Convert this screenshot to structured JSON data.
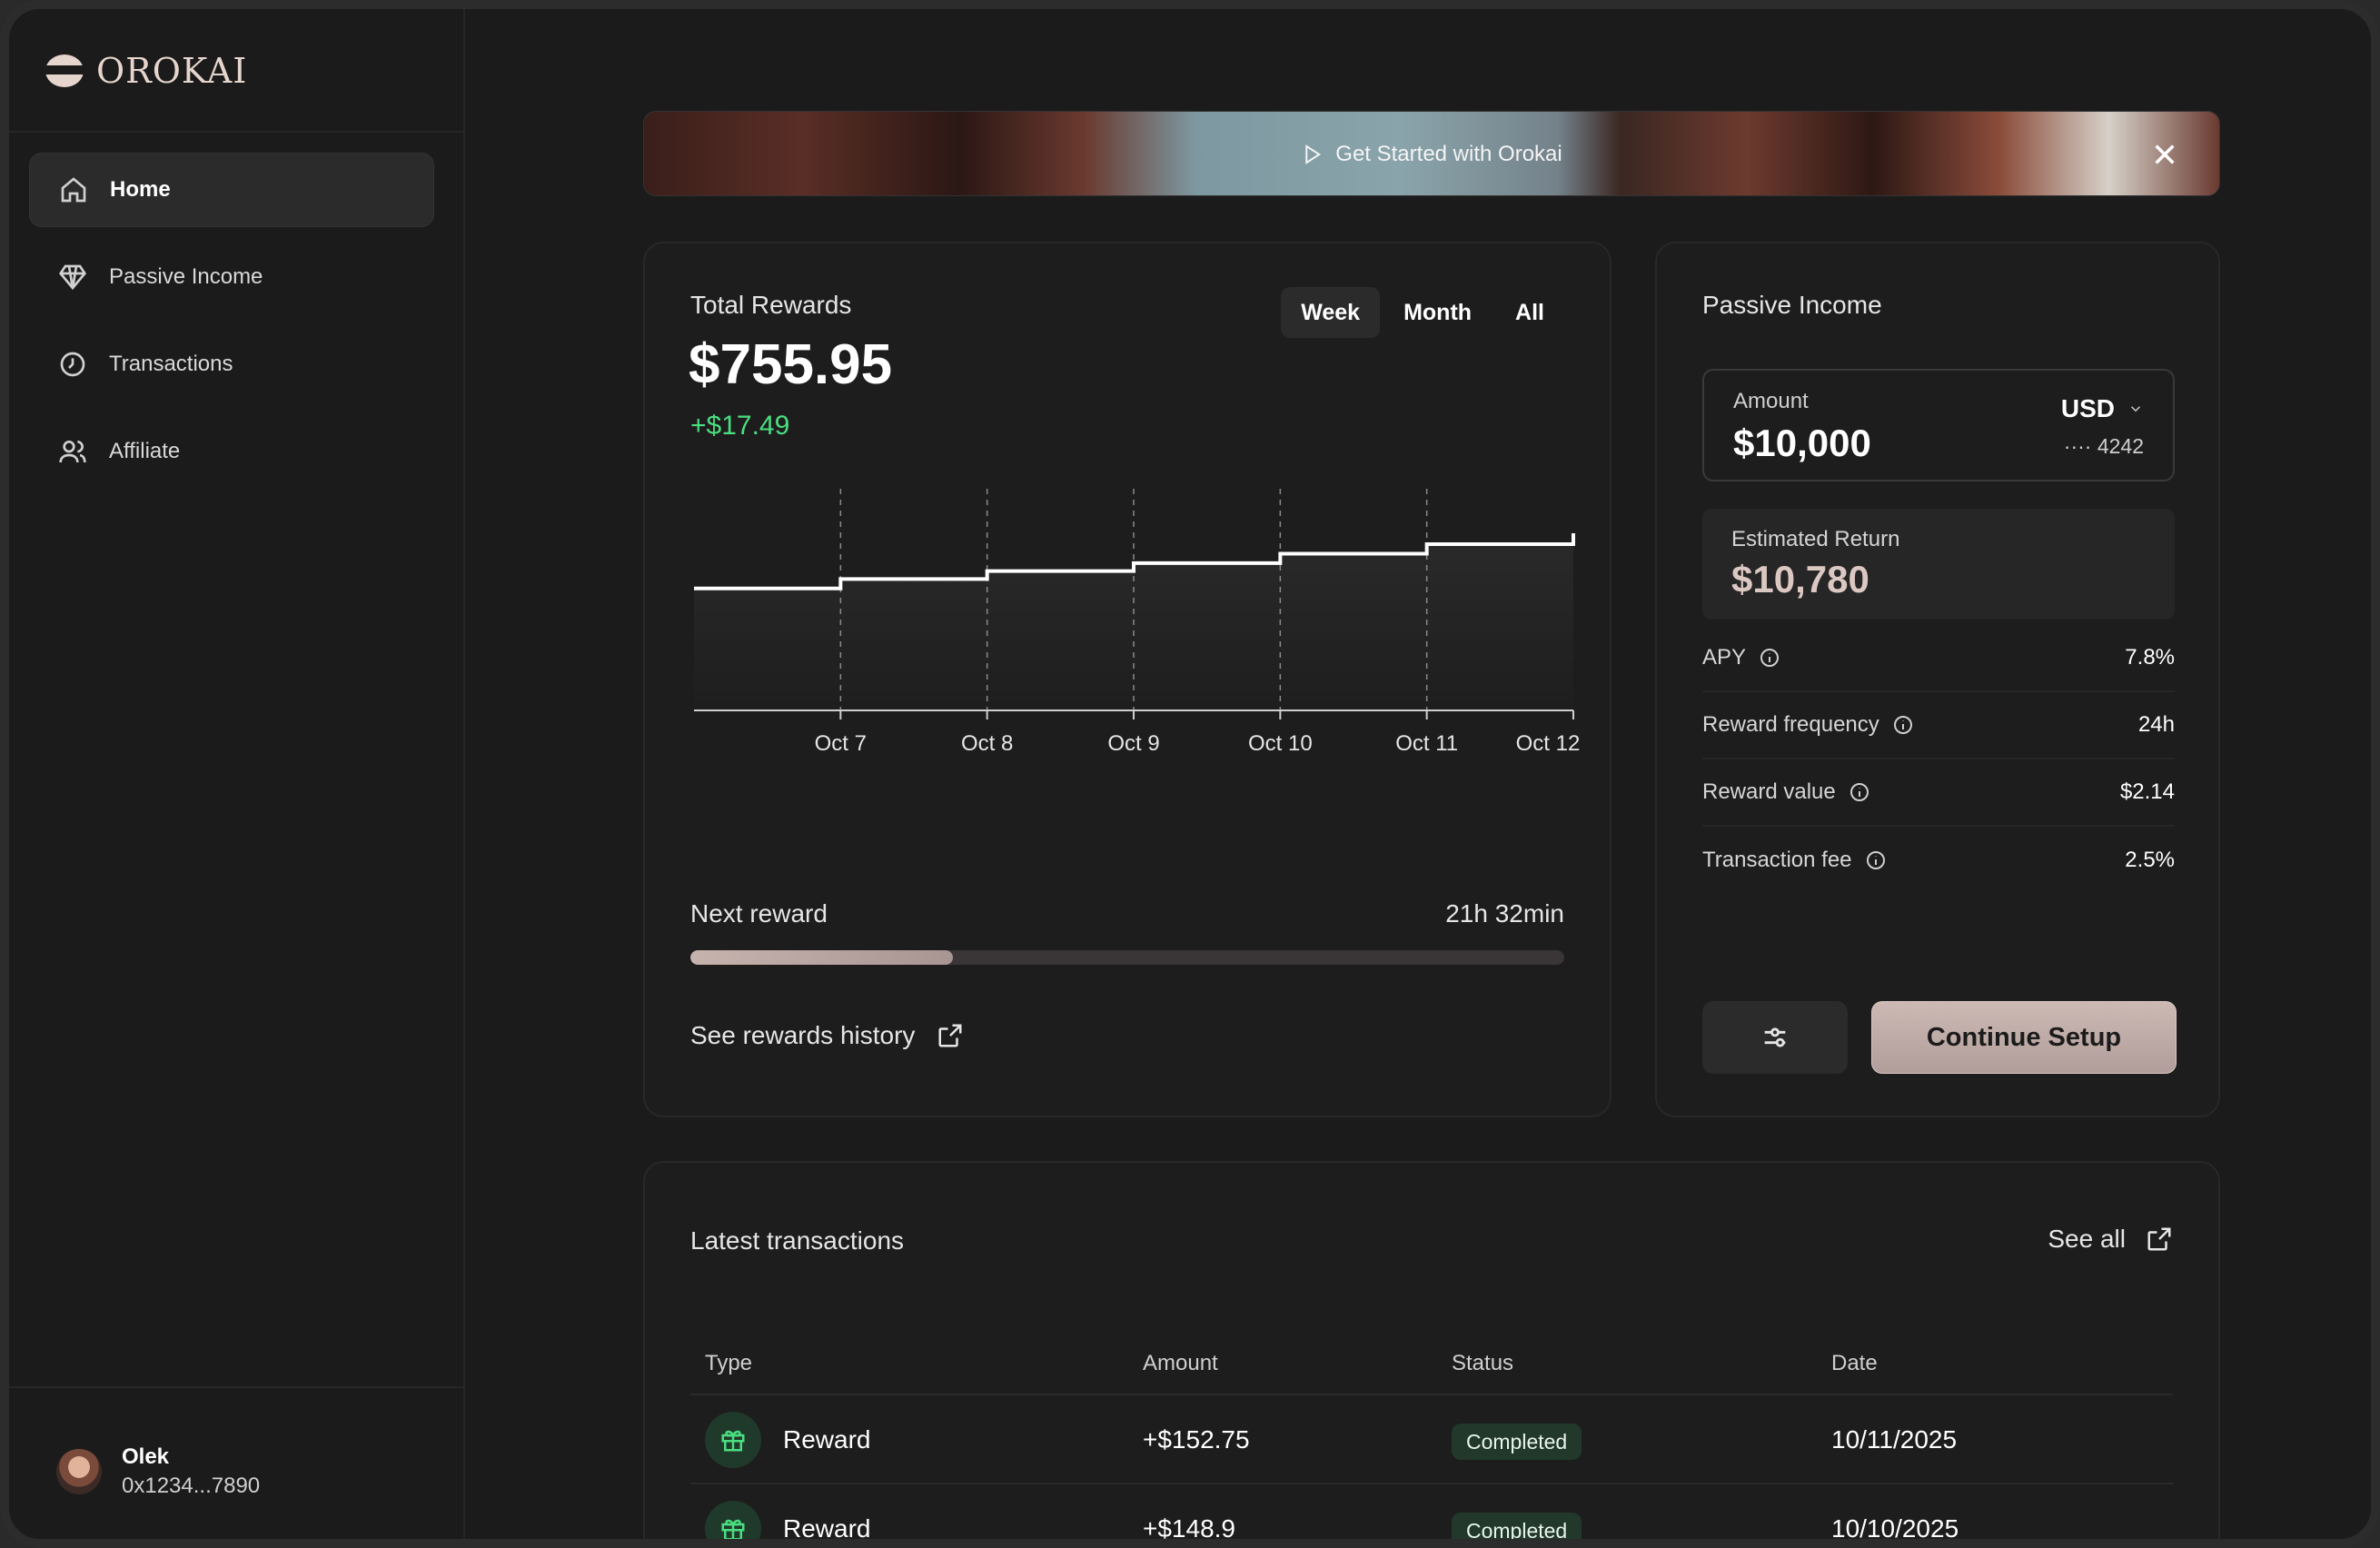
{
  "brand": {
    "name": "OROKAI"
  },
  "sidebar": {
    "items": [
      {
        "label": "Home",
        "icon": "home-icon",
        "active": true
      },
      {
        "label": "Passive Income",
        "icon": "diamond-icon",
        "active": false
      },
      {
        "label": "Transactions",
        "icon": "clock-icon",
        "active": false
      },
      {
        "label": "Affiliate",
        "icon": "users-icon",
        "active": false
      }
    ],
    "user": {
      "name": "Olek",
      "address": "0x1234...7890"
    }
  },
  "banner": {
    "cta": "Get Started with Orokai"
  },
  "rewards": {
    "label": "Total Rewards",
    "total": "$755.95",
    "delta": "+$17.49",
    "ranges": [
      "Week",
      "Month",
      "All"
    ],
    "active_range": "Week",
    "next_reward_label": "Next reward",
    "next_reward_time": "21h 32min",
    "progress": 0.3,
    "history_link": "See rewards history"
  },
  "chart_data": {
    "type": "area",
    "categories": [
      "",
      "Oct 7",
      "Oct 8",
      "Oct 9",
      "Oct 10",
      "Oct 11",
      "Oct 12"
    ],
    "tick_labels": [
      "Oct 7",
      "Oct 8",
      "Oct 9",
      "Oct 10",
      "Oct 11",
      "Oct 12"
    ],
    "values": [
      738.5,
      741.5,
      744,
      746.5,
      749.5,
      752.5,
      755.95
    ],
    "ylim": [
      700,
      770
    ],
    "grid": "dashed vertical",
    "colors": {
      "line": "#ffffff",
      "fill": "#262626"
    }
  },
  "passive": {
    "title": "Passive Income",
    "amount_label": "Amount",
    "amount_value": "$10,000",
    "currency": "USD",
    "card_last": "···· 4242",
    "estimated_label": "Estimated Return",
    "estimated_value": "$10,780",
    "stats": [
      {
        "label": "APY",
        "value": "7.8%"
      },
      {
        "label": "Reward frequency",
        "value": "24h"
      },
      {
        "label": "Reward value",
        "value": "$2.14"
      },
      {
        "label": "Transaction fee",
        "value": "2.5%"
      }
    ],
    "continue_label": "Continue Setup"
  },
  "transactions": {
    "title": "Latest transactions",
    "see_all": "See all",
    "columns": [
      "Type",
      "Amount",
      "Status",
      "Date"
    ],
    "rows": [
      {
        "type": "Reward",
        "amount": "+$152.75",
        "status": "Completed",
        "date": "10/11/2025"
      },
      {
        "type": "Reward",
        "amount": "+$148.9",
        "status": "Completed",
        "date": "10/10/2025"
      }
    ]
  },
  "colors": {
    "accent": "#4ade80",
    "button": "#c4b0ab",
    "background": "#1b1b1b"
  }
}
